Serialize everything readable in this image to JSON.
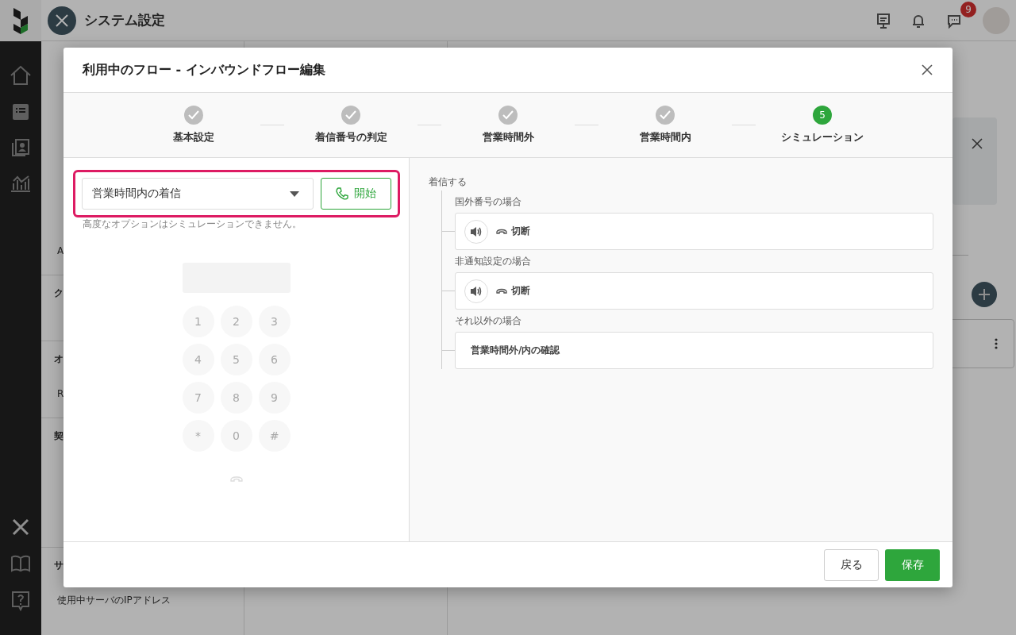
{
  "app": {
    "title": "システム設定",
    "notification_badge": "9"
  },
  "settings_menu": [
    {
      "kind": "item",
      "label": "A",
      "selected": false
    },
    {
      "kind": "heading",
      "label": "ク"
    },
    {
      "kind": "heading",
      "label": "オ"
    },
    {
      "kind": "item",
      "label": "R",
      "selected": false
    },
    {
      "kind": "heading",
      "label": "契"
    },
    {
      "kind": "heading",
      "label": "サ"
    },
    {
      "kind": "item",
      "label": "使用中サーバのIPアドレス",
      "selected": false
    }
  ],
  "dialog": {
    "title": "利用中のフロー - インバウンドフロー編集",
    "steps": [
      {
        "label": "基本設定",
        "done": true,
        "selected": false
      },
      {
        "label": "着信番号の判定",
        "done": true,
        "selected": false
      },
      {
        "label": "営業時間外",
        "done": true,
        "selected": false
      },
      {
        "label": "営業時間内",
        "done": true,
        "selected": false
      },
      {
        "label": "シミュレーション",
        "done": false,
        "selected": true,
        "number": "5"
      }
    ],
    "simulation": {
      "highlighted": true,
      "scenario": "営業時間内の着信",
      "start_button": "開始",
      "note": "高度なオプションはシミュレーションできません。",
      "keypad": [
        "1",
        "2",
        "3",
        "4",
        "5",
        "6",
        "7",
        "8",
        "9",
        "*",
        "0",
        "#"
      ]
    },
    "flow": {
      "root": "着信する",
      "branches": [
        {
          "label": "国外番号の場合",
          "kind": "action",
          "action": "切断"
        },
        {
          "label": "非通知設定の場合",
          "kind": "action",
          "action": "切断"
        },
        {
          "label": "それ以外の場合",
          "kind": "step",
          "action": "営業時間外/内の確認"
        }
      ]
    },
    "footer": {
      "back_button": "戻る",
      "save_button": "保存"
    }
  }
}
